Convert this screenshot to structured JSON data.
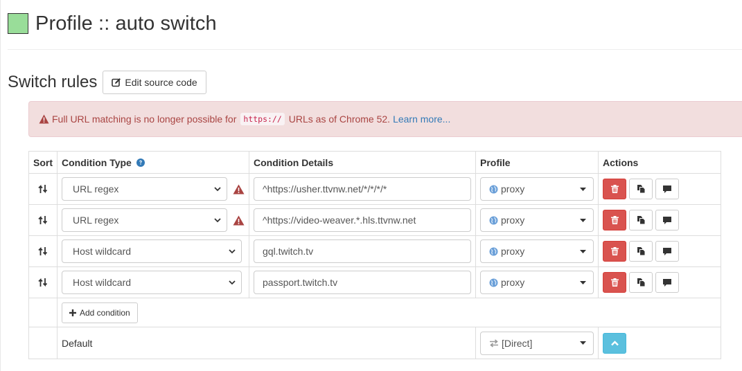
{
  "header": {
    "title": "Profile :: auto switch",
    "profile_color": "#99dd99"
  },
  "section": {
    "title": "Switch rules",
    "edit_source_label": "Edit source code"
  },
  "alert": {
    "text_before": "Full URL matching is no longer possible for",
    "code": "https://",
    "text_after": "URLs as of Chrome 52.",
    "link": "Learn more..."
  },
  "table": {
    "headers": {
      "sort": "Sort",
      "condition_type": "Condition Type",
      "condition_details": "Condition Details",
      "profile": "Profile",
      "actions": "Actions"
    },
    "rows": [
      {
        "condition_type": "URL regex",
        "details": "^https://usher.ttvnw.net/*/*/*/*",
        "profile": "proxy",
        "warning": true
      },
      {
        "condition_type": "URL regex",
        "details": "^https://video-weaver.*.hls.ttvnw.net",
        "profile": "proxy",
        "warning": true
      },
      {
        "condition_type": "Host wildcard",
        "details": "gql.twitch.tv",
        "profile": "proxy",
        "warning": false
      },
      {
        "condition_type": "Host wildcard",
        "details": "passport.twitch.tv",
        "profile": "proxy",
        "warning": false
      }
    ],
    "add_condition_label": "Add condition",
    "default_row": {
      "label": "Default",
      "profile": "[Direct]"
    }
  },
  "colors": {
    "danger": "#d9534f",
    "info": "#5bc0de",
    "alert_bg": "#f2dede",
    "alert_text": "#a94442",
    "link": "#337ab7",
    "help_icon": "#337ab7"
  }
}
